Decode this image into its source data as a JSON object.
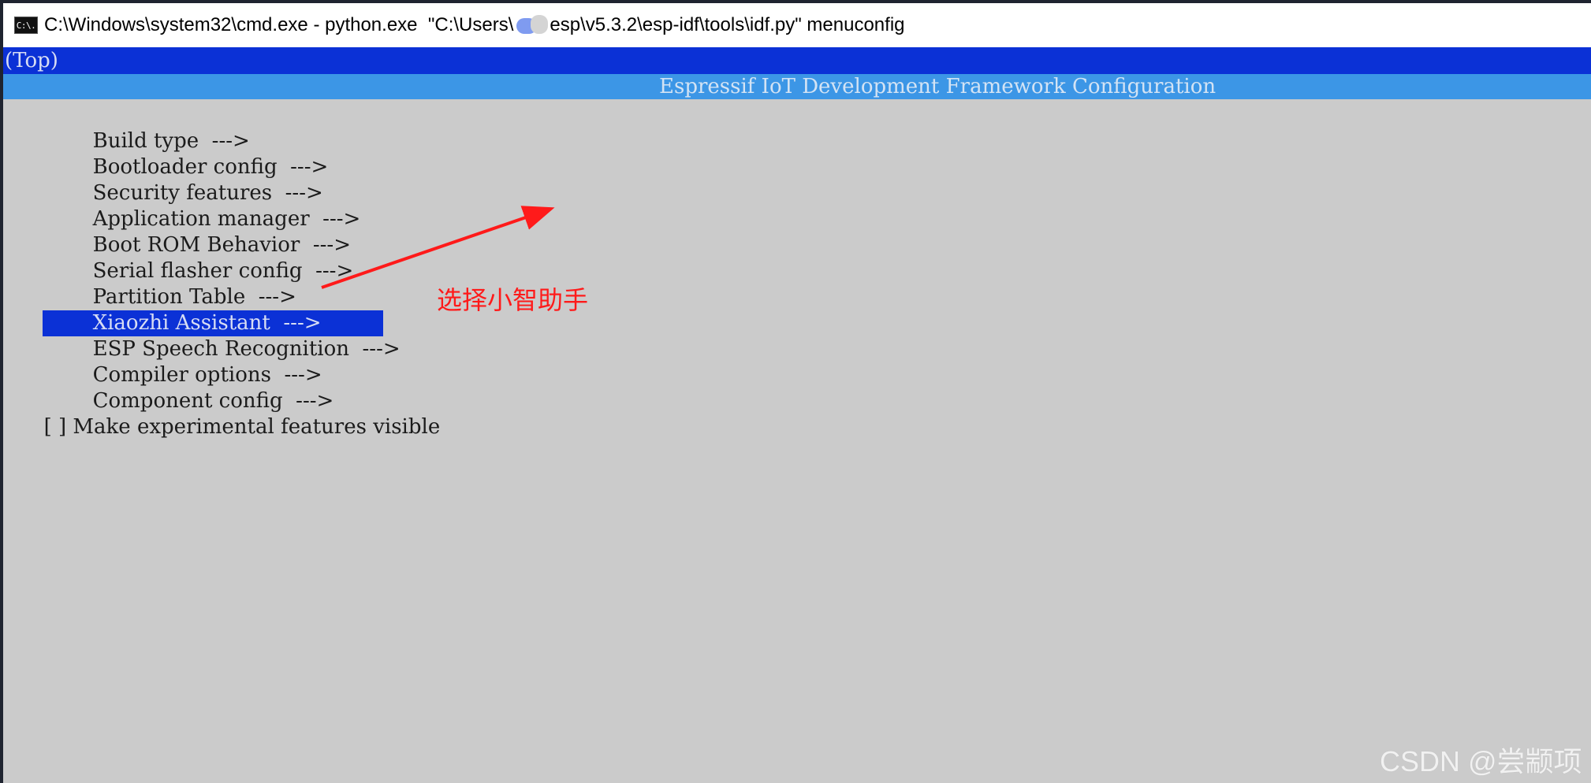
{
  "window": {
    "icon": "cmd-icon",
    "icon_text": "C:\\.",
    "title_prefix": "C:\\Windows\\system32\\cmd.exe - python.exe  \"C:\\Users\\",
    "title_suffix": "esp\\v5.3.2\\esp-idf\\tools\\idf.py\" menuconfig"
  },
  "breadcrumb": "(Top)",
  "header": {
    "title": "Espressif IoT Development Framework Configuration"
  },
  "menu": {
    "items": [
      {
        "label": "Build type  --->"
      },
      {
        "label": "Bootloader config  --->"
      },
      {
        "label": "Security features  --->"
      },
      {
        "label": "Application manager  --->"
      },
      {
        "label": "Boot ROM Behavior  --->"
      },
      {
        "label": "Serial flasher config  --->"
      },
      {
        "label": "Partition Table  --->"
      },
      {
        "label": "Xiaozhi Assistant  --->",
        "selected": true
      },
      {
        "label": "ESP Speech Recognition  --->"
      },
      {
        "label": "Compiler options  --->"
      },
      {
        "label": "Component config  --->"
      },
      {
        "label": "[ ] Make experimental features visible"
      }
    ]
  },
  "annotation": {
    "text": "选择小智助手",
    "color": "#ff1a1a"
  },
  "watermark": "CSDN @尝颛项",
  "colors": {
    "selection": "#0b31d6",
    "header": "#3c96e6",
    "background": "#cbcbcb"
  }
}
